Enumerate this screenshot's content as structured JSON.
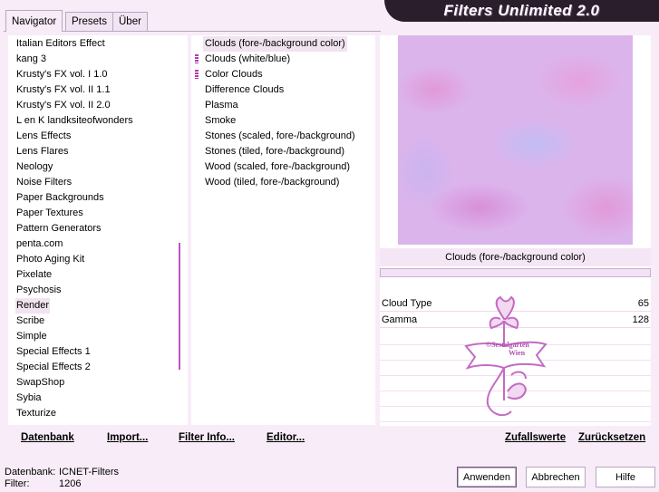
{
  "window": {
    "title": "Filters Unlimited 2.0",
    "tabs": [
      {
        "label": "Navigator",
        "active": true
      },
      {
        "label": "Presets",
        "active": false
      },
      {
        "label": "Über",
        "active": false
      }
    ]
  },
  "categories": [
    {
      "label": "Italian Editors Effect"
    },
    {
      "label": "kang 3"
    },
    {
      "label": "Krusty's FX vol. I 1.0"
    },
    {
      "label": "Krusty's FX vol. II 1.1"
    },
    {
      "label": "Krusty's FX vol. II 2.0"
    },
    {
      "label": "L en K landksiteofwonders"
    },
    {
      "label": "Lens Effects"
    },
    {
      "label": "Lens Flares"
    },
    {
      "label": "Neology"
    },
    {
      "label": "Noise Filters"
    },
    {
      "label": "Paper Backgrounds"
    },
    {
      "label": "Paper Textures"
    },
    {
      "label": "Pattern Generators"
    },
    {
      "label": "penta.com"
    },
    {
      "label": "Photo Aging Kit"
    },
    {
      "label": "Pixelate"
    },
    {
      "label": "Psychosis"
    },
    {
      "label": "Render",
      "selected": true
    },
    {
      "label": "Scribe"
    },
    {
      "label": "Simple"
    },
    {
      "label": "Special Effects 1"
    },
    {
      "label": "Special Effects 2"
    },
    {
      "label": "SwapShop"
    },
    {
      "label": "Sybia"
    },
    {
      "label": "Texturize"
    }
  ],
  "filters": [
    {
      "label": "Clouds (fore-/background color)",
      "selected": true,
      "marked": false
    },
    {
      "label": "Clouds (white/blue)",
      "marked": true
    },
    {
      "label": "Color Clouds",
      "marked": true
    },
    {
      "label": "Difference Clouds"
    },
    {
      "label": "Plasma"
    },
    {
      "label": "Smoke"
    },
    {
      "label": "Stones (scaled, fore-/background)"
    },
    {
      "label": "Stones (tiled, fore-/background)"
    },
    {
      "label": "Wood (scaled, fore-/background)"
    },
    {
      "label": "Wood (tiled, fore-/background)"
    }
  ],
  "preview": {
    "filter_name": "Clouds (fore-/background color)",
    "params": [
      {
        "label": "Cloud Type",
        "value": "65"
      },
      {
        "label": "Gamma",
        "value": "128"
      }
    ],
    "watermark_text": [
      "©Sestelgarten",
      "Wien"
    ]
  },
  "bottom_left_buttons": [
    {
      "label": "Datenbank"
    },
    {
      "label": "Import..."
    },
    {
      "label": "Filter Info..."
    },
    {
      "label": "Editor..."
    }
  ],
  "bottom_right_buttons": [
    {
      "label": "Zufallswerte"
    },
    {
      "label": "Zurücksetzen"
    }
  ],
  "status": {
    "database_label": "Datenbank:",
    "database_value": "ICNET-Filters",
    "filter_label": "Filter:",
    "filter_value": "1206"
  },
  "dialog_buttons": {
    "apply": "Anwenden",
    "cancel": "Abbrechen",
    "help": "Hilfe"
  },
  "colors": {
    "background": "#f7ecf7",
    "accent": "#c054c0",
    "banner": "#2a1e2c"
  }
}
